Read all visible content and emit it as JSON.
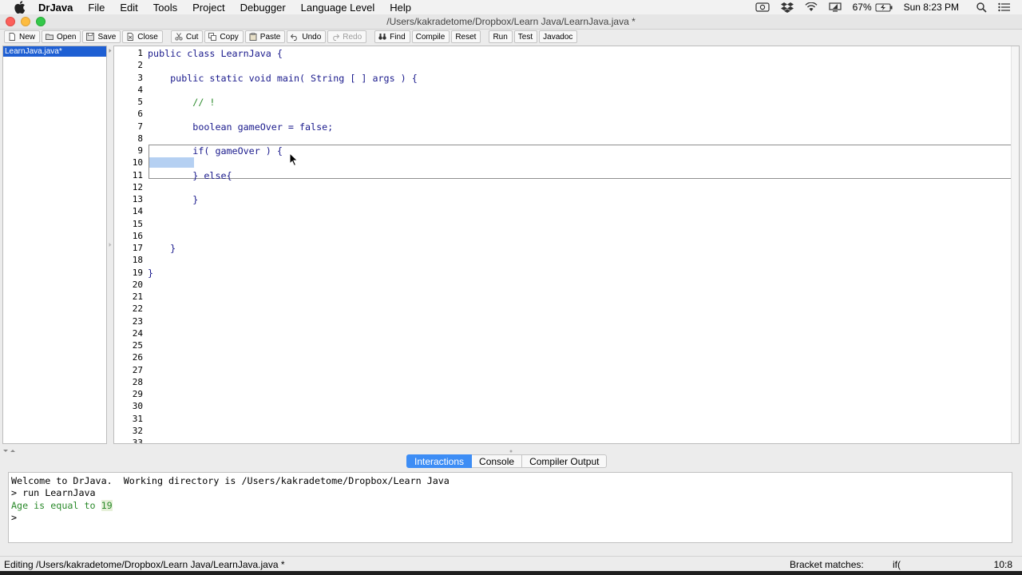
{
  "menubar": {
    "app_name": "DrJava",
    "items": [
      "File",
      "Edit",
      "Tools",
      "Project",
      "Debugger",
      "Language Level",
      "Help"
    ],
    "battery": "67%",
    "clock": "Sun 8:23 PM"
  },
  "window": {
    "title": "/Users/kakradetome/Dropbox/Learn Java/LearnJava.java *"
  },
  "toolbar": {
    "new": "New",
    "open": "Open",
    "save": "Save",
    "close": "Close",
    "cut": "Cut",
    "copy": "Copy",
    "paste": "Paste",
    "undo": "Undo",
    "redo": "Redo",
    "find": "Find",
    "compile": "Compile",
    "reset": "Reset",
    "run": "Run",
    "test": "Test",
    "javadoc": "Javadoc"
  },
  "files": {
    "selected": "LearnJava.java*"
  },
  "editor": {
    "line_numbers": [
      "1",
      "2",
      "3",
      "4",
      "5",
      "6",
      "7",
      "8",
      "9",
      "10",
      "11",
      "12",
      "13",
      "14",
      "15",
      "16",
      "17",
      "18",
      "19",
      "20",
      "21",
      "22",
      "23",
      "24",
      "25",
      "26",
      "27",
      "28",
      "29",
      "30",
      "31",
      "32",
      "33"
    ],
    "lines": [
      "public class LearnJava {",
      "",
      "    public static void main( String [ ] args ) {",
      "",
      "        // !",
      "",
      "        boolean gameOver = false;",
      "",
      "        if( gameOver ) {",
      "",
      "        } else{",
      "",
      "        }",
      "",
      "",
      "",
      "    }",
      "",
      "}"
    ]
  },
  "tabs": {
    "interactions": "Interactions",
    "console": "Console",
    "compiler_output": "Compiler Output"
  },
  "interactions": {
    "welcome": "Welcome to DrJava.  Working directory is /Users/kakradetome/Dropbox/Learn Java",
    "command": "> run LearnJava",
    "output_prefix": "Age is equal to ",
    "output_value": "19",
    "prompt": ">"
  },
  "status": {
    "editing": "Editing /Users/kakradetome/Dropbox/Learn Java/LearnJava.java *",
    "bracket_label": "Bracket matches:",
    "bracket_value": "if(",
    "position": "10:8"
  }
}
